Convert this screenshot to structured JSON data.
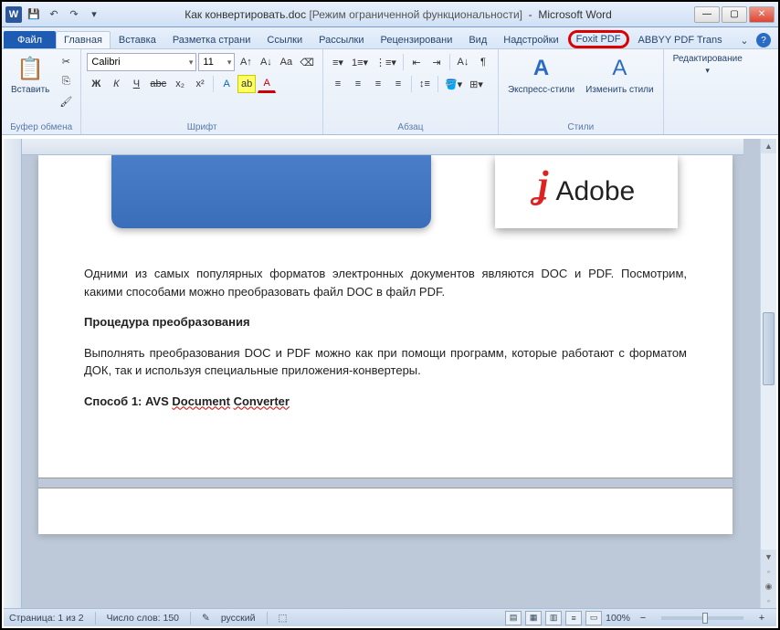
{
  "title": {
    "doc": "Как конвертировать.doc",
    "mode": "[Режим ограниченной функциональности]",
    "app": "Microsoft Word"
  },
  "qat": {
    "word_glyph": "W"
  },
  "tabs": {
    "file": "Файл",
    "home": "Главная",
    "insert": "Вставка",
    "layout": "Разметка страни",
    "refs": "Ссылки",
    "mail": "Рассылки",
    "review": "Рецензировани",
    "view": "Вид",
    "addins": "Надстройки",
    "foxit": "Foxit PDF",
    "abbyy": "ABBYY PDF Trans"
  },
  "ribbon": {
    "clipboard": {
      "paste": "Вставить",
      "label": "Буфер обмена"
    },
    "font": {
      "name": "Calibri",
      "size": "11",
      "bold": "Ж",
      "italic": "К",
      "underline": "Ч",
      "strike": "abc",
      "sub": "x₂",
      "sup": "x²",
      "label": "Шрифт"
    },
    "para": {
      "label": "Абзац"
    },
    "styles": {
      "quick": "Экспресс-стили",
      "change": "Изменить стили",
      "label": "Стили"
    },
    "editing": {
      "label": "Редактирование"
    }
  },
  "doc": {
    "adobe": "Adobe",
    "p1": "Одними из самых популярных форматов электронных документов являются DOC и PDF. Посмотрим, какими способами можно преобразовать файл DOC в файл PDF.",
    "p2": "Процедура преобразования",
    "p3": "Выполнять преобразования DOC и PDF можно как при помощи программ, которые работают с форматом ДОК, так и используя специальные приложения-конвертеры.",
    "p4a": "Способ 1: AVS ",
    "p4b": "Document",
    "p4c": " ",
    "p4d": "Converter"
  },
  "status": {
    "page": "Страница: 1 из 2",
    "words": "Число слов: 150",
    "lang": "русский",
    "zoom": "100%"
  }
}
